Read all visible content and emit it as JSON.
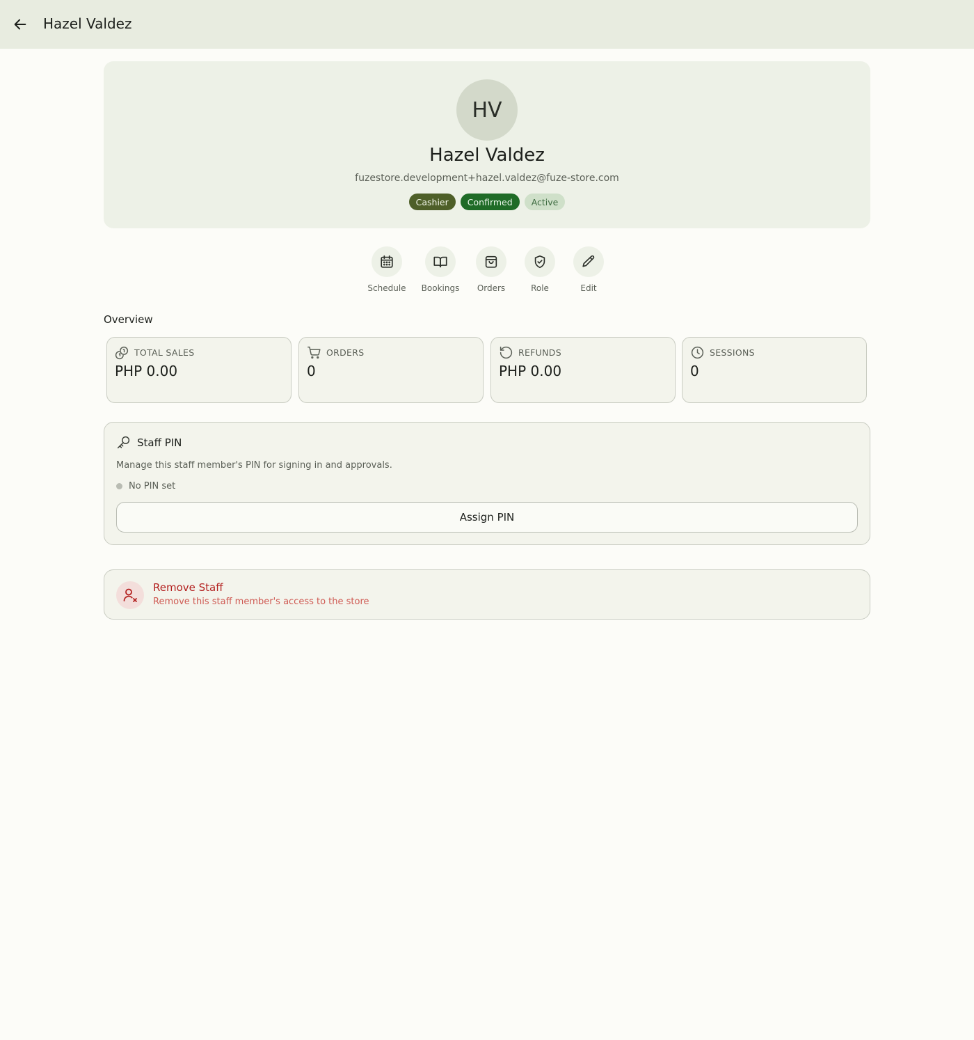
{
  "header": {
    "title": "Hazel Valdez",
    "back_icon": "arrow-left-icon"
  },
  "profile": {
    "initials": "HV",
    "name": "Hazel Valdez",
    "email": "fuzestore.development+hazel.valdez@fuze-store.com",
    "badges": {
      "role": "Cashier",
      "confirmation": "Confirmed",
      "status": "Active"
    }
  },
  "actions": [
    {
      "label": "Schedule",
      "icon": "calendar-icon"
    },
    {
      "label": "Bookings",
      "icon": "book-open-icon"
    },
    {
      "label": "Orders",
      "icon": "shopping-bag-icon"
    },
    {
      "label": "Role",
      "icon": "shield-check-icon"
    },
    {
      "label": "Edit",
      "icon": "pencil-icon"
    }
  ],
  "overview": {
    "title": "Overview",
    "stats": [
      {
        "label": "TOTAL SALES",
        "value": "PHP 0.00",
        "icon": "coins-icon"
      },
      {
        "label": "ORDERS",
        "value": "0",
        "icon": "cart-icon"
      },
      {
        "label": "REFUNDS",
        "value": "PHP 0.00",
        "icon": "rotate-ccw-icon"
      },
      {
        "label": "SESSIONS",
        "value": "0",
        "icon": "clock-icon"
      }
    ]
  },
  "pin": {
    "title": "Staff PIN",
    "description": "Manage this staff member's PIN for signing in and approvals.",
    "status": "No PIN set",
    "button_label": "Assign PIN",
    "icon": "key-icon"
  },
  "remove": {
    "title": "Remove Staff",
    "description": "Remove this staff member's access to the store",
    "icon": "user-remove-icon"
  },
  "colors": {
    "topbar": "#e8ece0",
    "card": "#edf1e7",
    "badge_role": "#4e5f28",
    "badge_confirmed": "#1f6b27",
    "badge_active": "#cfe0c9",
    "danger": "#b3201f"
  }
}
